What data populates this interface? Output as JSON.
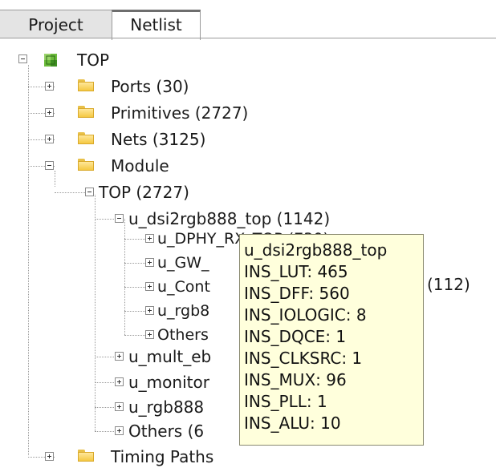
{
  "tabs": [
    {
      "label": "Project",
      "active": false
    },
    {
      "label": "Netlist",
      "active": true
    }
  ],
  "tree": {
    "top": "TOP",
    "ports": "Ports (30)",
    "primitives": "Primitives (2727)",
    "nets": "Nets (3125)",
    "module": "Module",
    "top_module": "TOP  (2727)",
    "dsi2rgb888_top": "u_dsi2rgb888_top  (1142)",
    "dphy_rx_top": "u_DPHY_RX_TOP  (730)",
    "gw": "u_GW_",
    "cont": "u_Cont",
    "cont_count": "(112)",
    "rgb8": "u_rgb8",
    "others_inner": "Others",
    "mult_eb": "u_mult_eb",
    "monitor": "u_monitor",
    "rgb888": "u_rgb888",
    "others_outer": "Others  (6",
    "timing_paths": "Timing Paths"
  },
  "tooltip": {
    "title": "u_dsi2rgb888_top",
    "lines": [
      "INS_LUT: 465",
      "INS_DFF: 560",
      "INS_IOLOGIC: 8",
      "INS_DQCE: 1",
      "INS_CLKSRC: 1",
      "INS_MUX: 96",
      "INS_PLL: 1",
      "INS_ALU: 10"
    ]
  },
  "colors": {
    "tooltip_bg": "#ffffdc",
    "folder": "#f5c842",
    "chip": "#4caf50"
  },
  "icons": [
    "expand-plus-icon",
    "collapse-minus-icon",
    "folder-icon",
    "chip-icon"
  ]
}
